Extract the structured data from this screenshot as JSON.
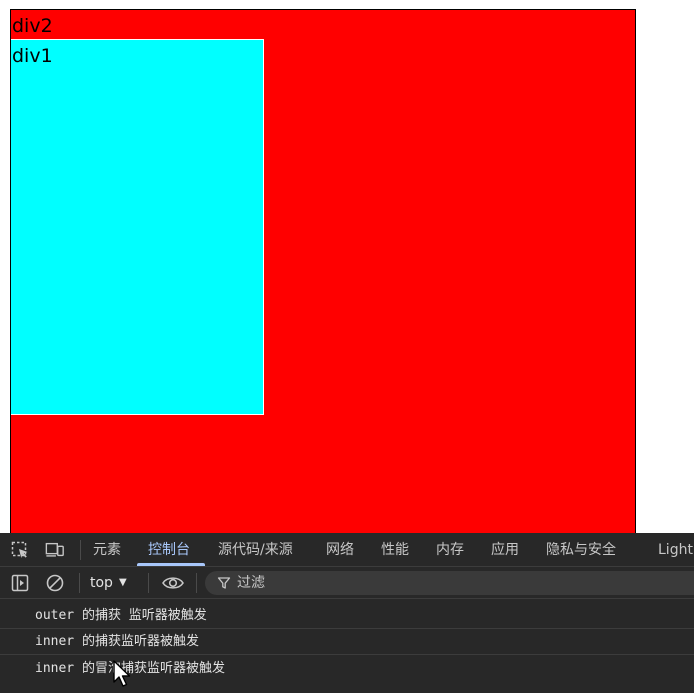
{
  "content": {
    "outer_label": "div2",
    "inner_label": "div1",
    "colors": {
      "outer_bg": "#ff0000",
      "inner_bg": "#00ffff"
    }
  },
  "devtools": {
    "tabs": [
      {
        "label": "元素",
        "active": false
      },
      {
        "label": "控制台",
        "active": true
      },
      {
        "label": "源代码/来源",
        "active": false
      },
      {
        "label": "网络",
        "active": false
      },
      {
        "label": "性能",
        "active": false
      },
      {
        "label": "内存",
        "active": false
      },
      {
        "label": "应用",
        "active": false
      },
      {
        "label": "隐私与安全",
        "active": false
      },
      {
        "label": "Light",
        "active": false
      }
    ],
    "toolbar": {
      "context": "top",
      "filter_placeholder": "过滤"
    },
    "console_messages": [
      "outer 的捕获 监听器被触发",
      "inner 的捕获监听器被触发",
      "inner 的冒泡捕获监听器被触发"
    ],
    "colors": {
      "panel_bg": "#282828",
      "active_tab": "#a8c7fa"
    },
    "icons": {
      "inspect": "inspect-element-icon",
      "device": "device-toolbar-icon",
      "sidebar": "sidebar-toggle-icon",
      "clear": "clear-console-icon",
      "eye": "live-expression-eye-icon",
      "filter": "filter-icon"
    }
  }
}
